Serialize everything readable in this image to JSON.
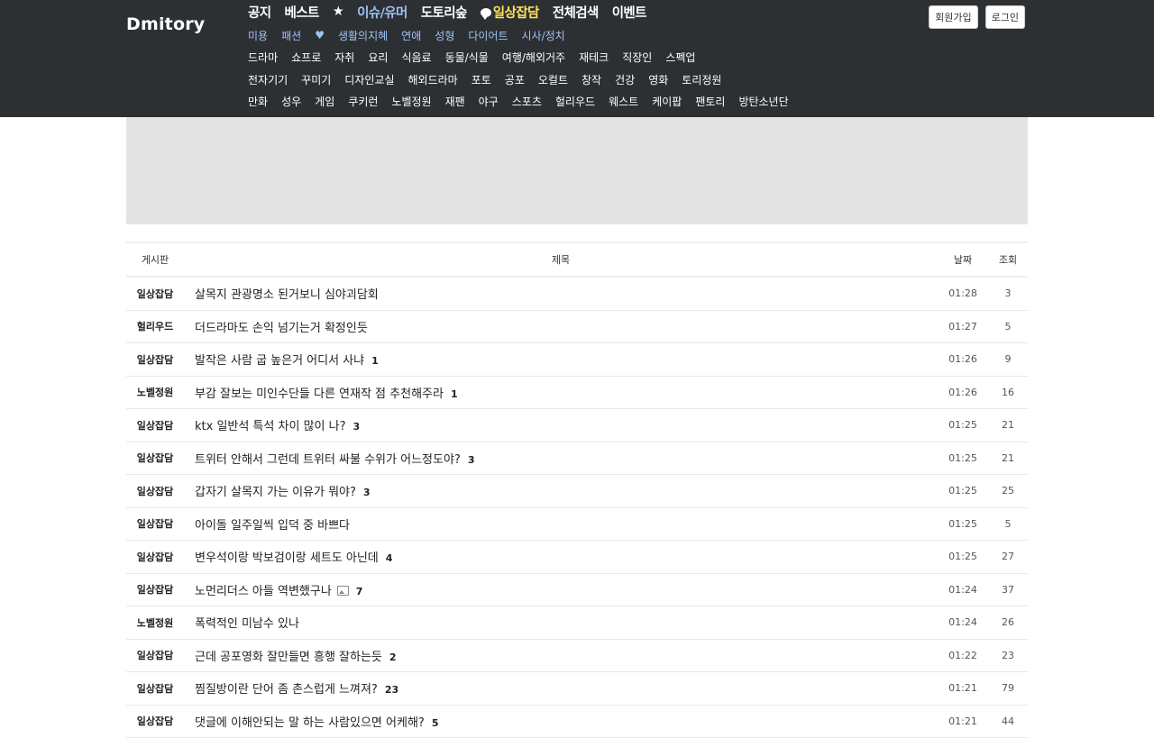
{
  "header": {
    "logo": "Dmitory",
    "signup": "회원가입",
    "login": "로그인",
    "main_nav": [
      {
        "label": "공지",
        "color": "white"
      },
      {
        "label": "베스트",
        "color": "white"
      },
      {
        "label": "★",
        "color": "white"
      },
      {
        "label": "이슈/유머",
        "color": "blue"
      },
      {
        "label": "도토리숲",
        "color": "white"
      },
      {
        "label": "일상잡담",
        "color": "yellow",
        "icon": "speech-bubble-icon"
      },
      {
        "label": "전체검색",
        "color": "white"
      },
      {
        "label": "이벤트",
        "color": "white"
      }
    ],
    "sub_nav": [
      "미용",
      "패션",
      "♥",
      "생활의지혜",
      "연애",
      "성형",
      "다이어트",
      "시사/정치"
    ],
    "cat_row1": [
      "드라마",
      "쇼프로",
      "자취",
      "요리",
      "식음료",
      "동물/식물",
      "여행/해외거주",
      "재테크",
      "직장인",
      "스펙업"
    ],
    "cat_row2": [
      "전자기기",
      "꾸미기",
      "디자인교실",
      "해외드라마",
      "포토",
      "공포",
      "오컬트",
      "창작",
      "건강",
      "영화",
      "토리정원"
    ],
    "cat_row3": [
      "만화",
      "성우",
      "게임",
      "쿠키런",
      "노벨정원",
      "재팬",
      "야구",
      "스포츠",
      "헐리우드",
      "웨스트",
      "케이팝",
      "팬토리",
      "방탄소년단"
    ]
  },
  "table": {
    "headers": {
      "board": "게시판",
      "title": "제목",
      "date": "날짜",
      "views": "조회"
    },
    "rows": [
      {
        "board": "일상잡담",
        "title": "살목지 관광명소 된거보니 심야괴담회",
        "comments": "",
        "has_image": false,
        "date": "01:28",
        "views": "3"
      },
      {
        "board": "헐리우드",
        "title": "더드라마도 손익 넘기는거 확정인듯",
        "comments": "",
        "has_image": false,
        "date": "01:27",
        "views": "5"
      },
      {
        "board": "일상잡담",
        "title": "발작은 사람 굽 높은거 어디서 사냐",
        "comments": "1",
        "has_image": false,
        "date": "01:26",
        "views": "9"
      },
      {
        "board": "노벨정원",
        "title": "부감 잘보는 미인수단들 다른 연재작 점 추천해주라",
        "comments": "1",
        "has_image": false,
        "date": "01:26",
        "views": "16"
      },
      {
        "board": "일상잡담",
        "title": "ktx 일반석 특석 차이 많이 나?",
        "comments": "3",
        "has_image": false,
        "date": "01:25",
        "views": "21"
      },
      {
        "board": "일상잡담",
        "title": "트위터 안해서 그런데 트위터 싸불 수위가 어느정도야?",
        "comments": "3",
        "has_image": false,
        "date": "01:25",
        "views": "21"
      },
      {
        "board": "일상잡담",
        "title": "갑자기 살목지 가는 이유가 뭐야?",
        "comments": "3",
        "has_image": false,
        "date": "01:25",
        "views": "25"
      },
      {
        "board": "일상잡담",
        "title": "아이돌 일주일씩 입덕 중 바쁘다",
        "comments": "",
        "has_image": false,
        "date": "01:25",
        "views": "5"
      },
      {
        "board": "일상잡담",
        "title": "변우석이랑 박보검이랑 세트도 아닌데",
        "comments": "4",
        "has_image": false,
        "date": "01:25",
        "views": "27"
      },
      {
        "board": "일상잡담",
        "title": "노먼리더스 아들 역변했구나",
        "comments": "7",
        "has_image": true,
        "date": "01:24",
        "views": "37"
      },
      {
        "board": "노벨정원",
        "title": "폭력적인 미남수 있나",
        "comments": "",
        "has_image": false,
        "date": "01:24",
        "views": "26"
      },
      {
        "board": "일상잡담",
        "title": "근데 공포영화 잘만들면 흥행 잘하는듯",
        "comments": "2",
        "has_image": false,
        "date": "01:22",
        "views": "23"
      },
      {
        "board": "일상잡담",
        "title": "찜질방이란 단어 좀 촌스럽게 느껴져?",
        "comments": "23",
        "has_image": false,
        "date": "01:21",
        "views": "79"
      },
      {
        "board": "일상잡담",
        "title": "댓글에 이해안되는 말 하는 사람있으면 어케해?",
        "comments": "5",
        "has_image": false,
        "date": "01:21",
        "views": "44"
      }
    ]
  }
}
